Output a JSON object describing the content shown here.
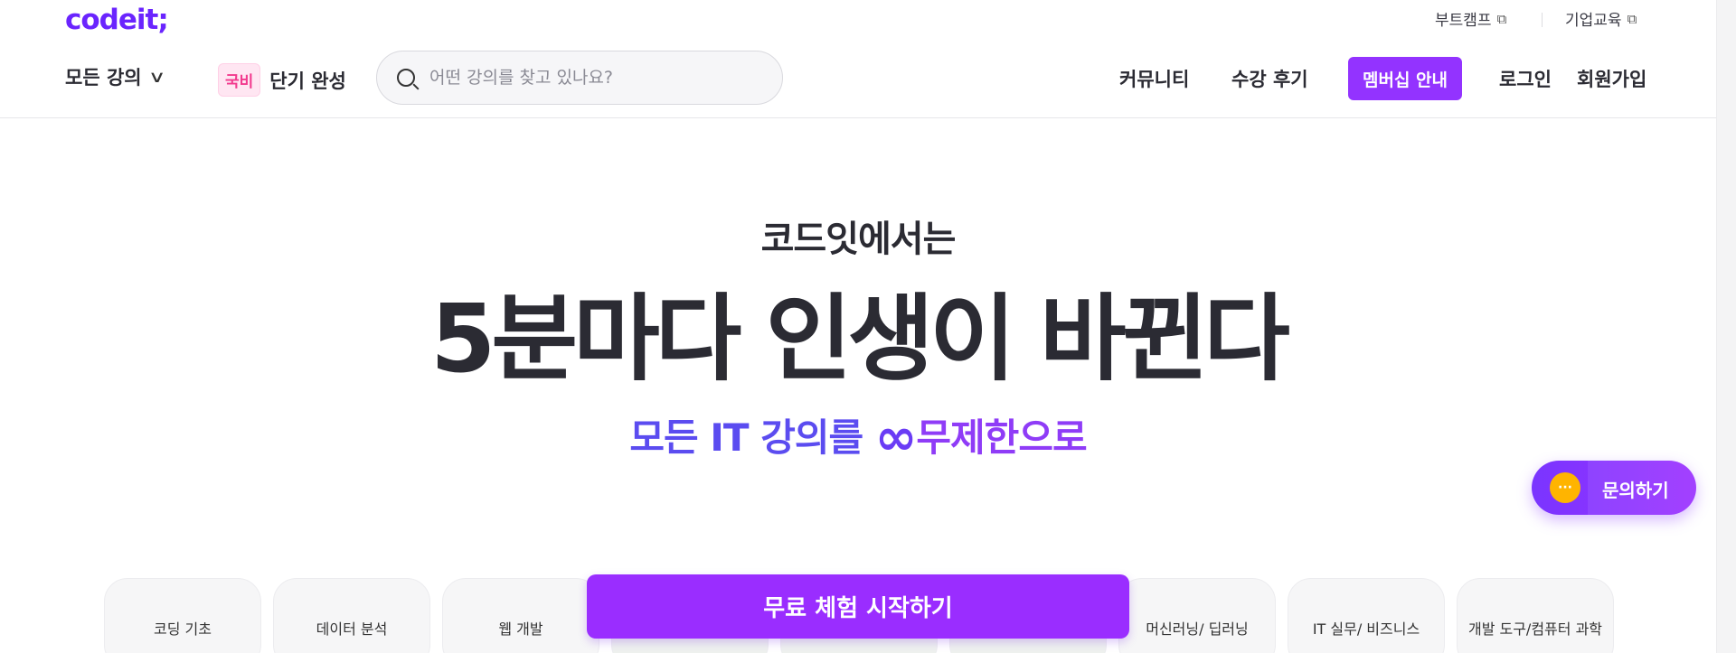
{
  "header": {
    "logo": "codeit;",
    "util_links": [
      {
        "label": "부트캠프",
        "icon": "external-link-icon"
      },
      {
        "label": "기업교육",
        "icon": "external-link-icon"
      }
    ],
    "all_courses": "모든 강의",
    "badge": "국비",
    "short_course": "단기 완성",
    "search_placeholder": "어떤 강의를 찾고 있나요?",
    "community": "커뮤니티",
    "reviews": "수강 후기",
    "membership": "멤버십 안내",
    "login": "로그인",
    "signup": "회원가입"
  },
  "hero": {
    "sub": "코드잇에서는",
    "title": "5분마다 인생이 바뀐다",
    "tag_a": "모든 IT 강의를",
    "tag_inf": "∞",
    "tag_b": "무제한으로"
  },
  "inquiry": {
    "label": "문의하기",
    "bubble": "···"
  },
  "categories": [
    "코딩 기초",
    "데이터 분석",
    "웹 개발",
    "",
    "",
    "",
    "머신러닝/ 딥러닝",
    "IT 실무/ 비즈니스",
    "개발 도구/컴퓨터 과학"
  ],
  "cta": "무료 체험 시작하기",
  "colors": {
    "brand": "#6a24fe",
    "cta": "#9a2dff",
    "membership": "#9333ff",
    "inquiry_bubble": "#ffb400"
  }
}
